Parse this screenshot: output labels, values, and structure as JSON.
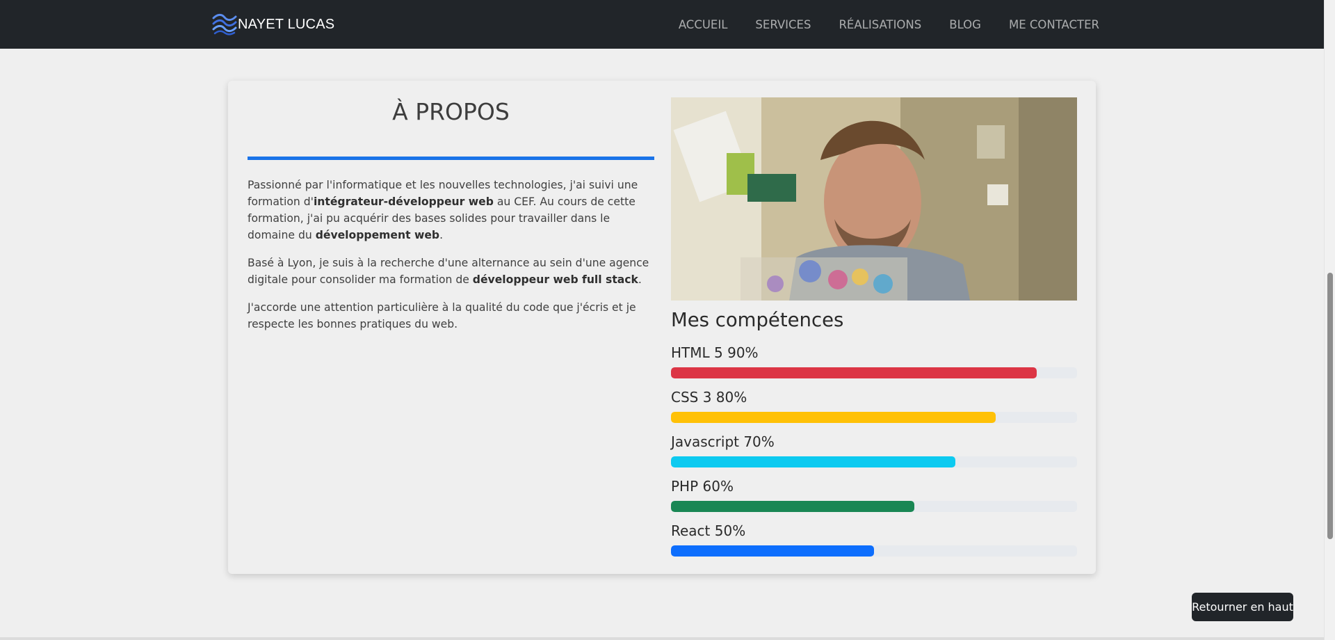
{
  "navbar": {
    "brand": "NAYET LUCAS",
    "links": [
      "ACCUEIL",
      "SERVICES",
      "RÉALISATIONS",
      "BLOG",
      "ME CONTACTER"
    ]
  },
  "about": {
    "title": "À PROPOS",
    "p1_a": "Passionné par l'informatique et les nouvelles technologies, j'ai suivi une formation d'",
    "p1_b": "intégrateur-développeur web",
    "p1_c": " au CEF. Au cours de cette formation, j'ai pu acquérir des bases solides pour travailler dans le domaine du ",
    "p1_d": "développement web",
    "p1_e": ".",
    "p2_a": "Basé à Lyon, je suis à la recherche d'une alternance au sein d'une agence digitale pour consolider ma formation de ",
    "p2_b": "développeur web full stack",
    "p2_c": ".",
    "p3": "J'accorde une attention particulière à la qualité du code que j'écris et je respecte les bonnes pratiques du web."
  },
  "skills": {
    "title": "Mes compétences",
    "items": [
      {
        "label": "HTML 5 90%",
        "percent": 90,
        "color": "#dc3545"
      },
      {
        "label": "CSS 3 80%",
        "percent": 80,
        "color": "#ffc107"
      },
      {
        "label": "Javascript 70%",
        "percent": 70,
        "color": "#0dcaf0"
      },
      {
        "label": "PHP 60%",
        "percent": 60,
        "color": "#198754"
      },
      {
        "label": "React 50%",
        "percent": 50,
        "color": "#0d6efd"
      }
    ]
  },
  "back_to_top": "Retourner en haut",
  "colors": {
    "navbar_bg": "#212529",
    "accent": "#1a73e8"
  }
}
